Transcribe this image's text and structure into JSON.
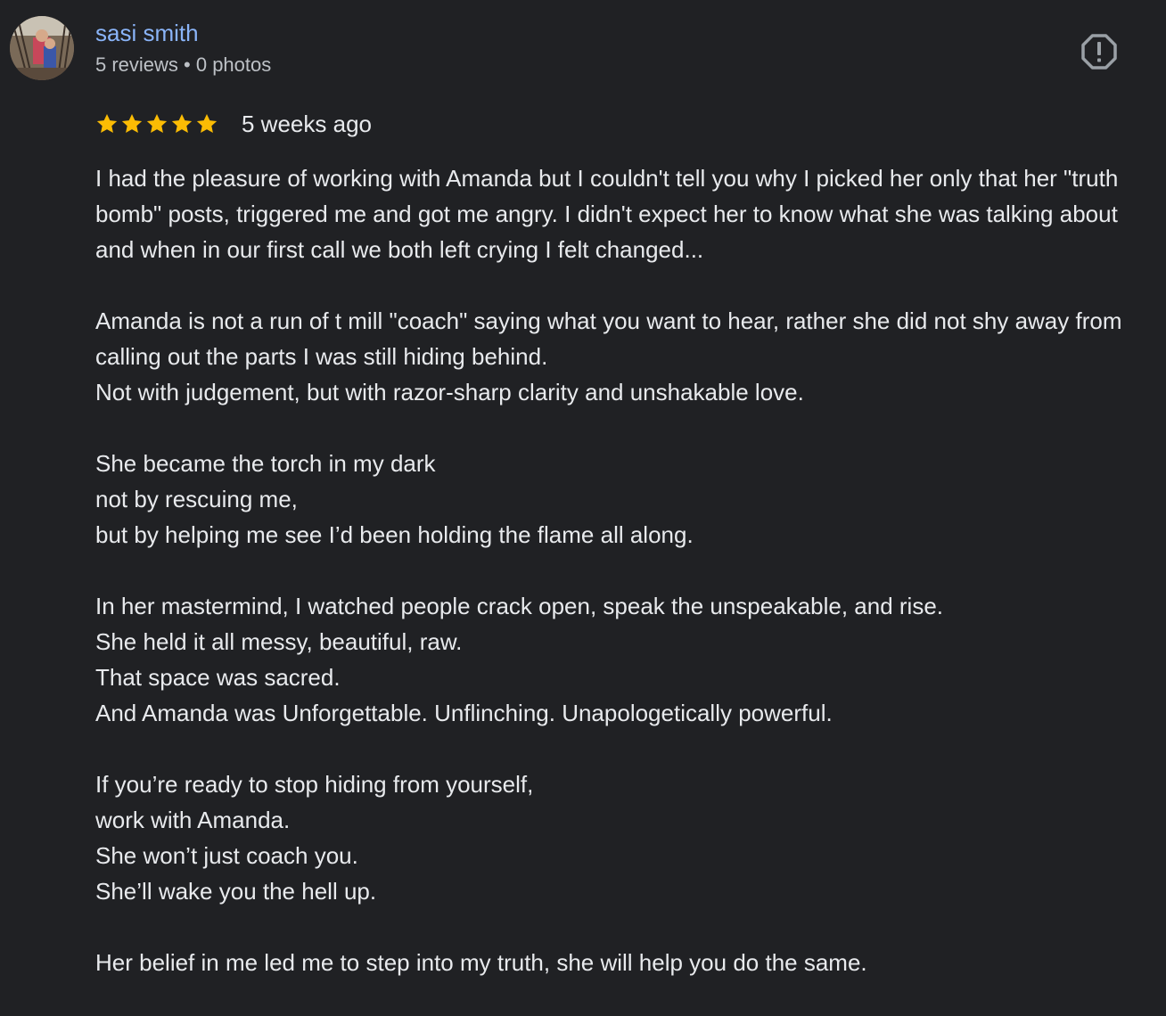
{
  "author": {
    "name": "sasi smith",
    "meta": "5 reviews • 0 photos"
  },
  "review": {
    "rating": 5,
    "date": "5 weeks ago",
    "paragraphs": [
      [
        "I had the pleasure of working with Amanda but I couldn't tell you why I picked her only that her \"truth bomb\" posts, triggered me and got me angry. I didn't expect her to know what she was talking about and when in our first call we both left crying I felt changed..."
      ],
      [
        "Amanda is not a run of t mill \"coach\" saying what you want to hear, rather she did not shy away from calling out the parts I was still hiding behind.",
        "Not with judgement, but with razor-sharp clarity and unshakable love."
      ],
      [
        "She became the torch in my dark",
        "not by rescuing me,",
        "but by helping me see I’d been holding the flame all along."
      ],
      [
        "In her mastermind, I watched people crack open, speak the unspeakable, and rise.",
        "She held it all messy, beautiful, raw.",
        "That space was sacred.",
        "And Amanda was Unforgettable. Unflinching. Unapologetically powerful."
      ],
      [
        "If you’re ready to stop hiding from yourself,",
        "work with Amanda.",
        "She won’t just coach you.",
        "She’ll wake you the hell up."
      ],
      [
        "Her belief in me led me to step into my truth, she will help you do the same."
      ]
    ]
  },
  "icons": {
    "star": "star-icon",
    "report": "report-flag-icon"
  },
  "colors": {
    "background": "#202124",
    "author_link": "#8ab4f8",
    "star": "#fbbc04",
    "text": "#e8eaed",
    "meta": "#bdc1c6"
  }
}
